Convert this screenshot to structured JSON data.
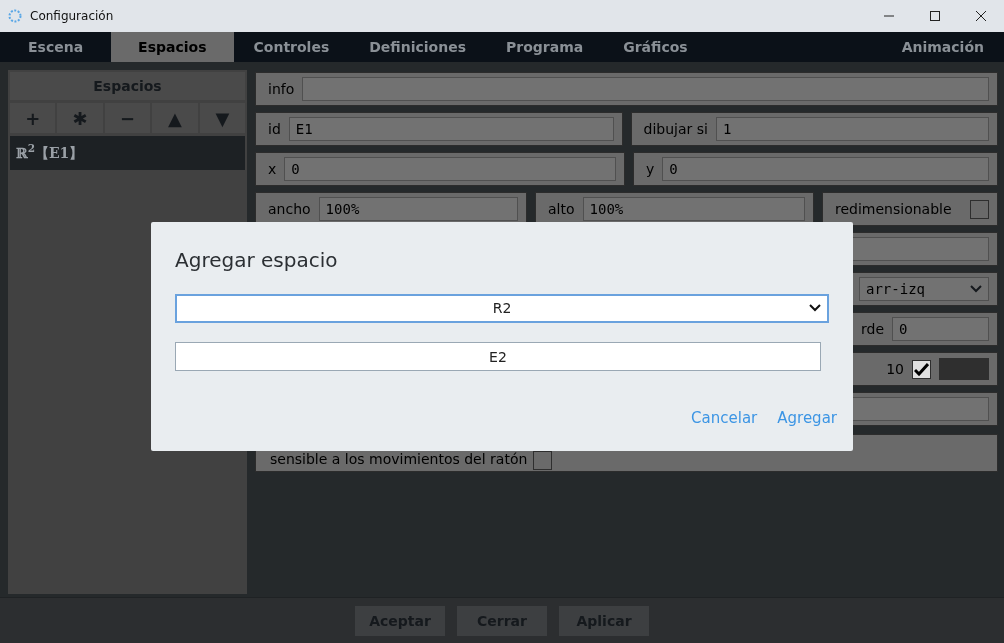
{
  "window": {
    "title": "Configuración"
  },
  "tabs": [
    {
      "label": "Escena",
      "selected": false
    },
    {
      "label": "Espacios",
      "selected": true
    },
    {
      "label": "Controles",
      "selected": false
    },
    {
      "label": "Definiciones",
      "selected": false
    },
    {
      "label": "Programa",
      "selected": false
    },
    {
      "label": "Gráficos",
      "selected": false
    },
    {
      "label": "Animación",
      "selected": false
    }
  ],
  "sidebar": {
    "title": "Espacios",
    "tools": [
      "+",
      "✱",
      "−",
      "▲",
      "▼"
    ],
    "items": [
      {
        "label": "ℝ$^{2}$【E1】",
        "selected": true
      }
    ]
  },
  "form": [
    {
      "kind": "full",
      "fields": [
        {
          "kind": "text",
          "label": "info"
        }
      ]
    },
    {
      "kind": "full",
      "fields": [
        {
          "kind": "text",
          "label": "id",
          "value": "E1"
        },
        {
          "kind": "text",
          "label": "dibujar si",
          "value": "1"
        }
      ]
    },
    {
      "kind": "full",
      "fields": [
        {
          "kind": "text",
          "label": "x",
          "value": "0"
        },
        {
          "kind": "text",
          "label": "y",
          "value": "0"
        }
      ]
    },
    {
      "kind": "full",
      "fields": [
        {
          "kind": "text",
          "label": "ancho",
          "value": "100%"
        },
        {
          "kind": "text",
          "label": "alto",
          "value": "100%"
        },
        {
          "kind": "checkbox",
          "label": "redimensionable",
          "checked": false
        }
      ]
    },
    {
      "kind": "tail",
      "fields": [
        {
          "kind": "text"
        }
      ]
    },
    {
      "kind": "tail",
      "fields": [
        {
          "kind": "select",
          "value": "arr-izq"
        }
      ]
    },
    {
      "kind": "tail",
      "fields": [
        {
          "kind": "text",
          "label": "rde",
          "value": "0"
        }
      ]
    },
    {
      "kind": "tail",
      "fields": [
        {
          "kind": "checkbox",
          "label": "10",
          "checked": true
        },
        {
          "kind": "color",
          "color": "#2f2f2f"
        }
      ]
    },
    {
      "kind": "tail",
      "fields": [
        {
          "kind": "text"
        }
      ]
    },
    {
      "kind": "below",
      "fields": [
        {
          "kind": "checkbox",
          "label": "sensible a los movimientos del ratón",
          "checked": false
        }
      ]
    }
  ],
  "footer": [
    "Aceptar",
    "Cerrar",
    "Aplicar"
  ],
  "modal": {
    "title": "Agregar espacio",
    "select": "R2",
    "input": "E2",
    "buttons": [
      "Cancelar",
      "Agregar"
    ]
  }
}
